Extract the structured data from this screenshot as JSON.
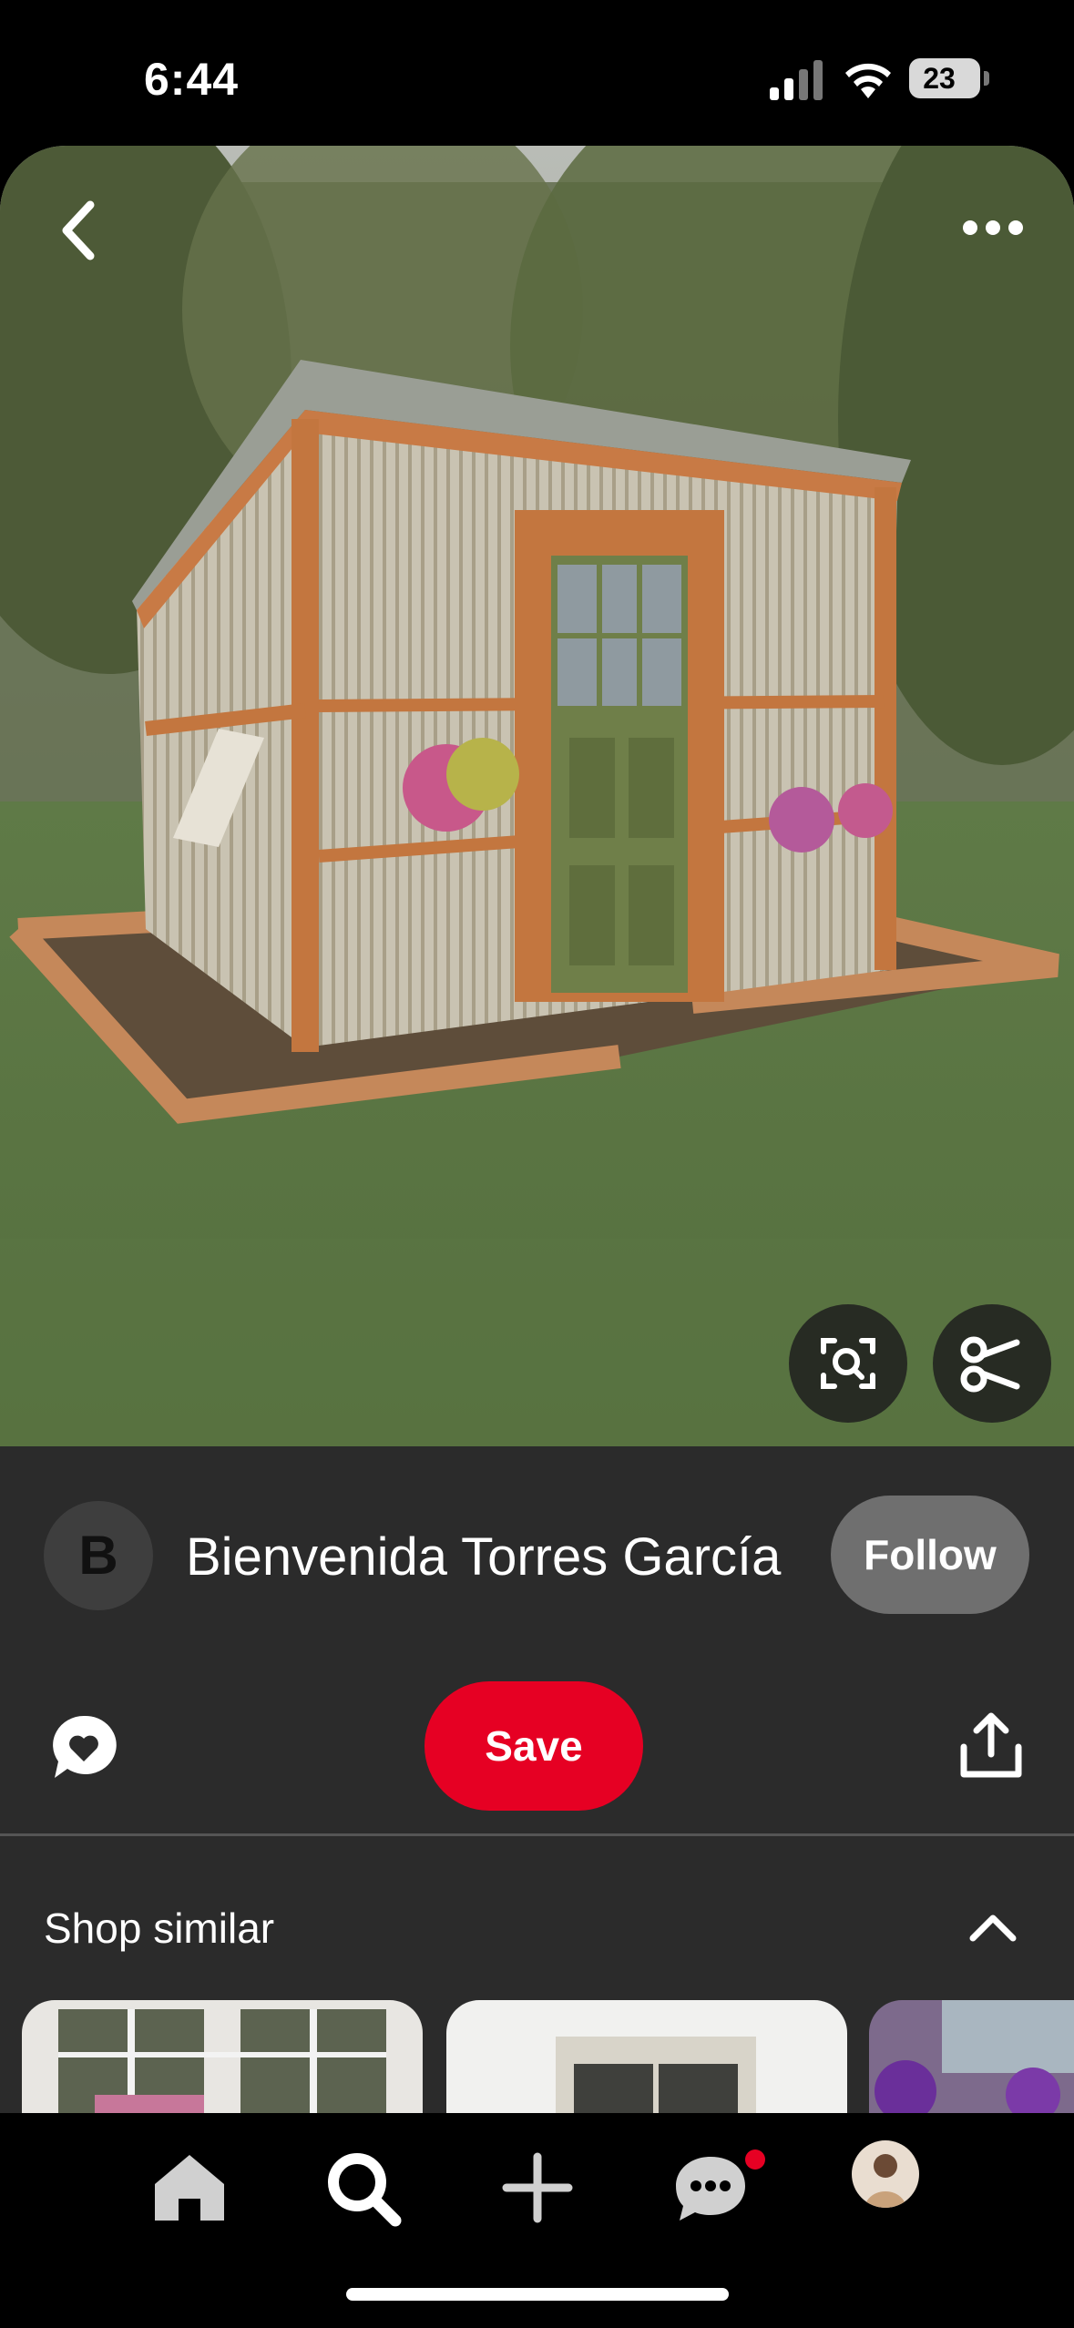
{
  "status_bar": {
    "time": "6:44",
    "battery": "23"
  },
  "pin": {
    "image_icons": {
      "back": "chevron-left-icon",
      "more": "more-horizontal-icon",
      "visual_search": "visual-search-icon",
      "cutout": "scissors-icon"
    },
    "author_initial": "B",
    "author_name": "Bienvenida Torres García",
    "follow_label": "Follow",
    "save_label": "Save",
    "comment_icon": "comment-heart-icon",
    "share_icon": "share-icon"
  },
  "shop_similar": {
    "title": "Shop similar",
    "toggle_icon": "chevron-up-icon",
    "items": [
      "product-1",
      "product-2",
      "product-3"
    ]
  },
  "bottom_nav": {
    "items": [
      "home-icon",
      "search-icon",
      "create-icon",
      "messages-icon",
      "profile-avatar"
    ],
    "active": "search-icon",
    "badge_color": "#e60023"
  },
  "colors": {
    "accent": "#e60023",
    "panel": "#2b2b2b",
    "follow": "#6f6f6f"
  }
}
